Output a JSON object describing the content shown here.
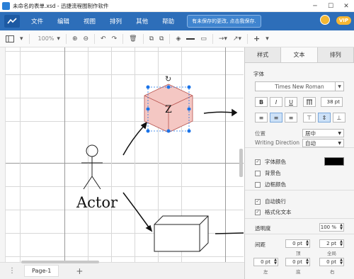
{
  "window": {
    "title": "未命名的表单.xsd - 迅捷流程图制作软件",
    "minimize": "─",
    "maximize": "☐",
    "close": "✕"
  },
  "menu": {
    "items": [
      "文件",
      "编辑",
      "视图",
      "排列",
      "其他",
      "帮助"
    ],
    "unsaved_notice": "有未保存的更改, 点击我保存.",
    "vip_label": "VIP"
  },
  "toolbar": {
    "zoom": "100%",
    "icons": [
      "page-view-icon",
      "zoom-in-icon",
      "zoom-out-icon",
      "undo-icon",
      "redo-icon",
      "delete-icon",
      "to-front-icon",
      "to-back-icon",
      "fill-color-icon",
      "line-color-icon",
      "shadow-icon",
      "connector-icon",
      "waypoints-icon",
      "insert-icon"
    ]
  },
  "canvas": {
    "actor_label": "Actor",
    "cube_label": "Z"
  },
  "bottom": {
    "page_tab": "Page-1",
    "add_page": "+",
    "menu_dots": "⋮"
  },
  "panel": {
    "tabs": [
      "样式",
      "文本",
      "排列"
    ],
    "active_tab": "文本",
    "font_section": "字体",
    "font_name": "Times New Roman",
    "bold": "B",
    "italic": "I",
    "underline": "U",
    "vertical": "T",
    "font_size": "38 pt",
    "position_label": "位置",
    "position_value": "居中",
    "writing_direction_label": "Writing Direction",
    "writing_direction_value": "自动",
    "font_color_label": "字体颜色",
    "font_color": "#000000",
    "background_color_label": "背景色",
    "border_color_label": "边框颜色",
    "word_wrap_label": "自动换行",
    "formatted_text_label": "格式化文本",
    "opacity_label": "透明度",
    "opacity_value": "100 %",
    "spacing_label": "间距",
    "spacing_top": "0 pt",
    "spacing_global": "2 pt",
    "spacing_top_label": "顶",
    "spacing_global_label": "全局",
    "spacing_left": "0 pt",
    "spacing_bottom": "0 pt",
    "spacing_right": "0 pt",
    "spacing_left_label": "左",
    "spacing_bottom_label": "底",
    "spacing_right_label": "右"
  },
  "colors": {
    "menubar": "#2d6eb9",
    "cube_fill": "#f4c7c3",
    "cube_stroke": "#b85450",
    "selection": "#1a73e8"
  }
}
